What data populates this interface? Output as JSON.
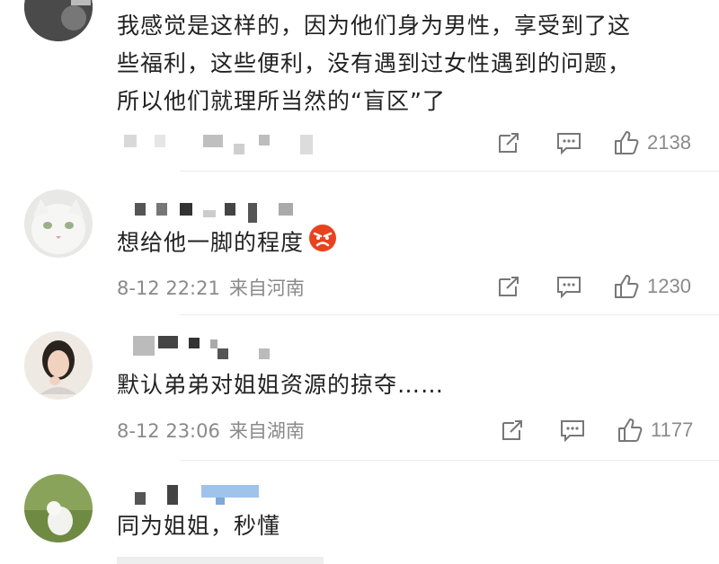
{
  "comments": [
    {
      "text_lines": [
        "我感觉是这样的，因为他们身为男性，享受到了这",
        "些福利，这些便利，没有遇到过女性遇到的问题，",
        "所以他们就理所当然的“盲区”了"
      ],
      "likes": "2138"
    },
    {
      "text": "想给他一脚的程度",
      "emoji": "angry-face",
      "date": "8-12 22:21",
      "location": "来自河南",
      "likes": "1230"
    },
    {
      "text": "默认弟弟对姐姐资源的掠夺……",
      "date": "8-12 23:06",
      "location": "来自湖南",
      "likes": "1177"
    },
    {
      "text": "同为姐姐，秒懂"
    }
  ],
  "icons": {
    "repost": "repost-icon",
    "comment": "comment-icon",
    "like": "like-icon"
  },
  "colors": {
    "meta_text": "#8a8a8a",
    "body_text": "#222222"
  }
}
